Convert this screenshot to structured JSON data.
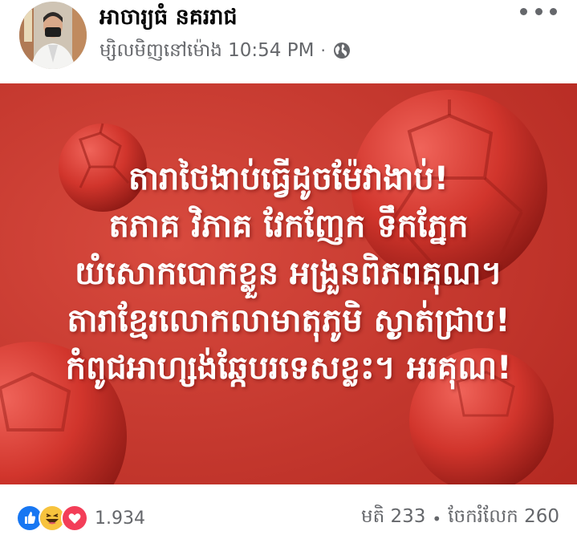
{
  "post": {
    "author": "អាចារ្យធំ នគររាជ",
    "timestamp": "ម្សិលមិញនៅម៉ោង 10:54 PM",
    "separator": "·",
    "audience_icon": "globe-icon",
    "more_icon": "more-options-icon",
    "image_text_lines": [
      "តារាថៃងាប់ធ្វើដូចម៉ែវាងាប់!",
      "តភាគ វិភាគ វែកញែក ទឹកភ្នែក",
      "យំសោកបោកខ្លួន អង្រួនពិភពគុណ។",
      "តារាខ្មែរលោកលាមាតុភូមិ ស្ងាត់ជ្រាប!",
      "កំពូជអាហ្សង់ឆ្កែបរទេសខ្លះ។ អរគុណ!"
    ],
    "image_background": "#c9332b"
  },
  "footer": {
    "reactions": [
      "like-icon",
      "haha-icon",
      "love-icon"
    ],
    "reaction_count": "1.934",
    "comments": "មតិ 233",
    "separator": "•",
    "shares": "ចែករំលែក 260"
  }
}
